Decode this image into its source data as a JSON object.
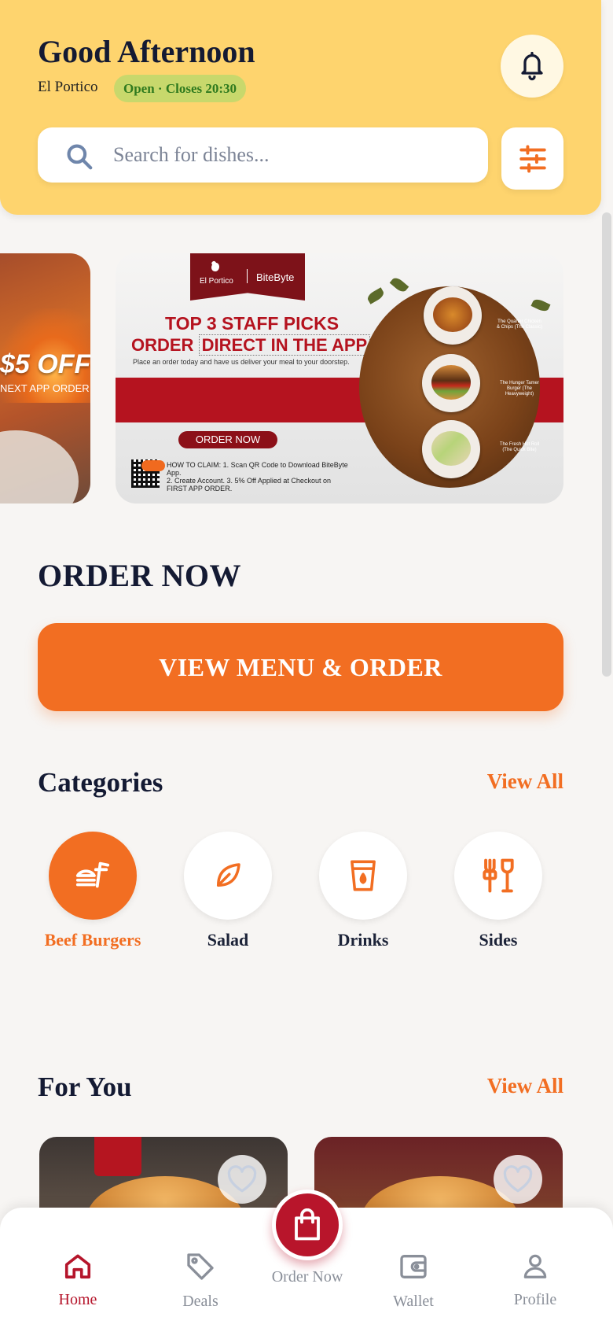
{
  "header": {
    "greeting": "Good Afternoon",
    "restaurant": "El Portico",
    "status": "Open · Closes 20:30",
    "bell_icon": "bell-icon",
    "filter_icon": "sliders-icon"
  },
  "search": {
    "placeholder": "Search for dishes...",
    "value": ""
  },
  "banner_prev": {
    "offer_text": "$5 OFF",
    "sub_text": "NEXT APP ORDER"
  },
  "banner": {
    "brand_left": "El Portico",
    "brand_right": "BiteByte",
    "headline_1": "TOP 3 STAFF PICKS",
    "headline_2_prefix": "ORDER",
    "headline_2_boxed": "DIRECT IN THE APP",
    "subline": "Place an order today and have us deliver your meal to your doorstep.",
    "order_now": "ORDER NOW",
    "claim_lines": [
      "HOW TO CLAIM: 1. Scan QR Code to Download BiteByte App.",
      "2. Create Account. 3. 5% Off Applied at Checkout on",
      "FIRST APP ORDER."
    ],
    "items": [
      "The Quarter Chicken & Chips (The Classic)",
      "The Hunger Tamer Burger (The Heavyweight)",
      "The Fresh Hot Roll (The Quick Bite)"
    ]
  },
  "order_section": {
    "title": "ORDER NOW",
    "cta": "VIEW MENU & ORDER"
  },
  "categories": {
    "title": "Categories",
    "view_all": "View All",
    "items": [
      {
        "label": "Beef Burgers",
        "icon": "burger-icon",
        "active": true
      },
      {
        "label": "Salad",
        "icon": "leaf-icon",
        "active": false
      },
      {
        "label": "Drinks",
        "icon": "cup-icon",
        "active": false
      },
      {
        "label": "Sides",
        "icon": "utensils-icon",
        "active": false
      }
    ]
  },
  "for_you": {
    "title": "For You",
    "view_all": "View All"
  },
  "nav": {
    "items": [
      {
        "label": "Home",
        "icon": "home-icon",
        "active": true
      },
      {
        "label": "Deals",
        "icon": "tag-icon",
        "active": false
      },
      {
        "label": "Order Now",
        "icon": "shopping-bag-icon",
        "active": false
      },
      {
        "label": "Wallet",
        "icon": "wallet-icon",
        "active": false
      },
      {
        "label": "Profile",
        "icon": "user-icon",
        "active": false
      }
    ]
  },
  "colors": {
    "header_bg": "#fed46e",
    "accent": "#f26e22",
    "brand_red": "#b8152b",
    "status_green": "#2f7a1e"
  }
}
